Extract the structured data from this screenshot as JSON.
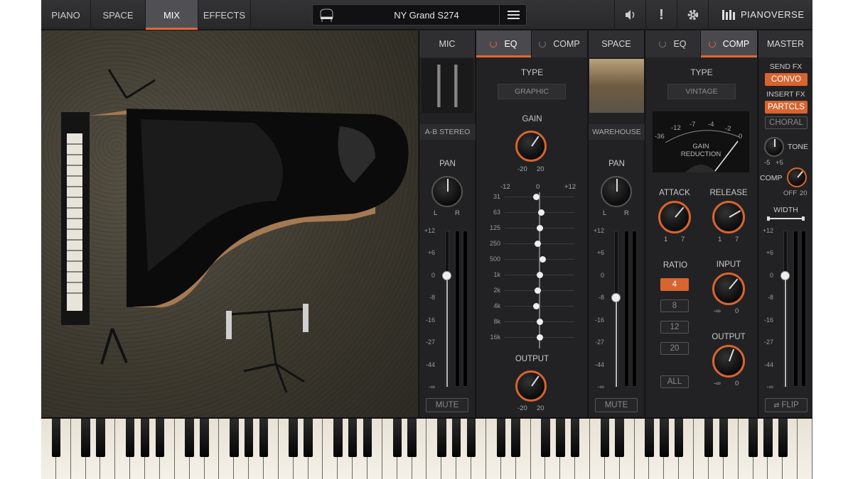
{
  "tabs": [
    "PIANO",
    "SPACE",
    "MIX",
    "EFFECTS"
  ],
  "active_tab": "MIX",
  "preset_name": "NY Grand S274",
  "brand": "PIANOVERSE",
  "mic": {
    "header": "MIC",
    "name": "A-B STEREO",
    "pan_label": "PAN",
    "pan_left": "L",
    "pan_right": "R",
    "mute_label": "MUTE",
    "fader_level_db": 0
  },
  "eq1": {
    "header": "EQ",
    "type_label": "TYPE",
    "type_value": "GRAPHIC",
    "gain_label": "GAIN",
    "gain_min": "-20",
    "gain_max": "20",
    "output_label": "OUTPUT",
    "output_min": "-20",
    "output_max": "20",
    "db_scale": [
      "-12",
      "0",
      "+12"
    ],
    "bands": [
      "31",
      "63",
      "125",
      "250",
      "500",
      "1k",
      "2k",
      "4k",
      "8k",
      "16k"
    ],
    "band_gains_db": [
      -1,
      0.5,
      0,
      -0.5,
      1,
      0,
      -0.5,
      -1,
      0,
      0
    ]
  },
  "comp1_header": "COMP",
  "space": {
    "header": "SPACE",
    "name": "WAREHOUSE",
    "pan_label": "PAN",
    "pan_left": "L",
    "pan_right": "R",
    "mute_label": "MUTE",
    "fader_level_db": -8
  },
  "eq2_header": "EQ",
  "comp2": {
    "header": "COMP",
    "type_label": "TYPE",
    "type_value": "VINTAGE",
    "meter_scale": [
      "-36",
      "-12",
      "-7",
      "-4",
      "-2",
      "0"
    ],
    "meter_label_1": "GAIN",
    "meter_label_2": "REDUCTION",
    "attack_label": "ATTACK",
    "attack_min": "1",
    "attack_max": "7",
    "release_label": "RELEASE",
    "release_min": "1",
    "release_max": "7",
    "ratio_label": "RATIO",
    "ratio_options": [
      "4",
      "8",
      "12",
      "20",
      "ALL"
    ],
    "ratio_selected": "4",
    "input_label": "INPUT",
    "input_min": "-∞",
    "input_max": "0",
    "output_label": "OUTPUT",
    "output_min": "-∞",
    "output_max": "0"
  },
  "master": {
    "header": "MASTER",
    "send_fx_label": "SEND FX",
    "send_fx_value": "CONVO",
    "insert_fx_label": "INSERT FX",
    "insert_fx_1": "PARTCLS",
    "insert_fx_2": "CHORAL",
    "tone_label": "TONE",
    "tone_min": "-5",
    "tone_max": "+5",
    "comp_label": "COMP",
    "comp_min": "OFF",
    "comp_max": "20",
    "width_label": "WIDTH",
    "flip_label": "FLIP",
    "fader_level_db": 0
  },
  "fader_scale": [
    "+12",
    "+6",
    "0",
    "-8",
    "-16",
    "-27",
    "-44",
    "-∞"
  ],
  "colors": {
    "accent": "#d8642f",
    "panel": "#222224",
    "header": "#2f2f32"
  }
}
